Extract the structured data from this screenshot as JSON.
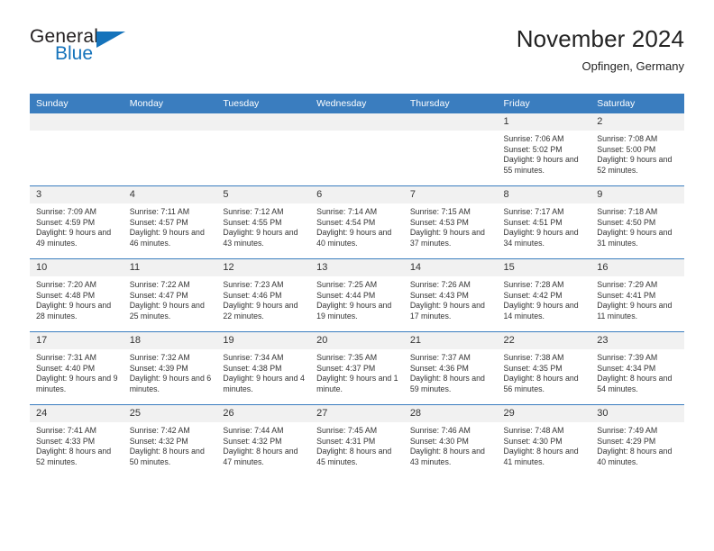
{
  "brand": {
    "name_part1": "General",
    "name_part2": "Blue",
    "triangle_icon": "triangle-icon",
    "accent_color": "#1573bb"
  },
  "header": {
    "title": "November 2024",
    "subtitle": "Opfingen, Germany",
    "header_bg_color": "#3a7dbf",
    "daynum_bg_color": "#f1f1f1"
  },
  "weekday_headers": [
    "Sunday",
    "Monday",
    "Tuesday",
    "Wednesday",
    "Thursday",
    "Friday",
    "Saturday"
  ],
  "labels": {
    "sunrise_prefix": "Sunrise:",
    "sunset_prefix": "Sunset:",
    "daylight_prefix": "Daylight:"
  },
  "weeks": [
    [
      {
        "day": "",
        "empty": true
      },
      {
        "day": "",
        "empty": true
      },
      {
        "day": "",
        "empty": true
      },
      {
        "day": "",
        "empty": true
      },
      {
        "day": "",
        "empty": true
      },
      {
        "day": "1",
        "sunrise": "Sunrise: 7:06 AM",
        "sunset": "Sunset: 5:02 PM",
        "daylight": "Daylight: 9 hours and 55 minutes."
      },
      {
        "day": "2",
        "sunrise": "Sunrise: 7:08 AM",
        "sunset": "Sunset: 5:00 PM",
        "daylight": "Daylight: 9 hours and 52 minutes."
      }
    ],
    [
      {
        "day": "3",
        "sunrise": "Sunrise: 7:09 AM",
        "sunset": "Sunset: 4:59 PM",
        "daylight": "Daylight: 9 hours and 49 minutes."
      },
      {
        "day": "4",
        "sunrise": "Sunrise: 7:11 AM",
        "sunset": "Sunset: 4:57 PM",
        "daylight": "Daylight: 9 hours and 46 minutes."
      },
      {
        "day": "5",
        "sunrise": "Sunrise: 7:12 AM",
        "sunset": "Sunset: 4:55 PM",
        "daylight": "Daylight: 9 hours and 43 minutes."
      },
      {
        "day": "6",
        "sunrise": "Sunrise: 7:14 AM",
        "sunset": "Sunset: 4:54 PM",
        "daylight": "Daylight: 9 hours and 40 minutes."
      },
      {
        "day": "7",
        "sunrise": "Sunrise: 7:15 AM",
        "sunset": "Sunset: 4:53 PM",
        "daylight": "Daylight: 9 hours and 37 minutes."
      },
      {
        "day": "8",
        "sunrise": "Sunrise: 7:17 AM",
        "sunset": "Sunset: 4:51 PM",
        "daylight": "Daylight: 9 hours and 34 minutes."
      },
      {
        "day": "9",
        "sunrise": "Sunrise: 7:18 AM",
        "sunset": "Sunset: 4:50 PM",
        "daylight": "Daylight: 9 hours and 31 minutes."
      }
    ],
    [
      {
        "day": "10",
        "sunrise": "Sunrise: 7:20 AM",
        "sunset": "Sunset: 4:48 PM",
        "daylight": "Daylight: 9 hours and 28 minutes."
      },
      {
        "day": "11",
        "sunrise": "Sunrise: 7:22 AM",
        "sunset": "Sunset: 4:47 PM",
        "daylight": "Daylight: 9 hours and 25 minutes."
      },
      {
        "day": "12",
        "sunrise": "Sunrise: 7:23 AM",
        "sunset": "Sunset: 4:46 PM",
        "daylight": "Daylight: 9 hours and 22 minutes."
      },
      {
        "day": "13",
        "sunrise": "Sunrise: 7:25 AM",
        "sunset": "Sunset: 4:44 PM",
        "daylight": "Daylight: 9 hours and 19 minutes."
      },
      {
        "day": "14",
        "sunrise": "Sunrise: 7:26 AM",
        "sunset": "Sunset: 4:43 PM",
        "daylight": "Daylight: 9 hours and 17 minutes."
      },
      {
        "day": "15",
        "sunrise": "Sunrise: 7:28 AM",
        "sunset": "Sunset: 4:42 PM",
        "daylight": "Daylight: 9 hours and 14 minutes."
      },
      {
        "day": "16",
        "sunrise": "Sunrise: 7:29 AM",
        "sunset": "Sunset: 4:41 PM",
        "daylight": "Daylight: 9 hours and 11 minutes."
      }
    ],
    [
      {
        "day": "17",
        "sunrise": "Sunrise: 7:31 AM",
        "sunset": "Sunset: 4:40 PM",
        "daylight": "Daylight: 9 hours and 9 minutes."
      },
      {
        "day": "18",
        "sunrise": "Sunrise: 7:32 AM",
        "sunset": "Sunset: 4:39 PM",
        "daylight": "Daylight: 9 hours and 6 minutes."
      },
      {
        "day": "19",
        "sunrise": "Sunrise: 7:34 AM",
        "sunset": "Sunset: 4:38 PM",
        "daylight": "Daylight: 9 hours and 4 minutes."
      },
      {
        "day": "20",
        "sunrise": "Sunrise: 7:35 AM",
        "sunset": "Sunset: 4:37 PM",
        "daylight": "Daylight: 9 hours and 1 minute."
      },
      {
        "day": "21",
        "sunrise": "Sunrise: 7:37 AM",
        "sunset": "Sunset: 4:36 PM",
        "daylight": "Daylight: 8 hours and 59 minutes."
      },
      {
        "day": "22",
        "sunrise": "Sunrise: 7:38 AM",
        "sunset": "Sunset: 4:35 PM",
        "daylight": "Daylight: 8 hours and 56 minutes."
      },
      {
        "day": "23",
        "sunrise": "Sunrise: 7:39 AM",
        "sunset": "Sunset: 4:34 PM",
        "daylight": "Daylight: 8 hours and 54 minutes."
      }
    ],
    [
      {
        "day": "24",
        "sunrise": "Sunrise: 7:41 AM",
        "sunset": "Sunset: 4:33 PM",
        "daylight": "Daylight: 8 hours and 52 minutes."
      },
      {
        "day": "25",
        "sunrise": "Sunrise: 7:42 AM",
        "sunset": "Sunset: 4:32 PM",
        "daylight": "Daylight: 8 hours and 50 minutes."
      },
      {
        "day": "26",
        "sunrise": "Sunrise: 7:44 AM",
        "sunset": "Sunset: 4:32 PM",
        "daylight": "Daylight: 8 hours and 47 minutes."
      },
      {
        "day": "27",
        "sunrise": "Sunrise: 7:45 AM",
        "sunset": "Sunset: 4:31 PM",
        "daylight": "Daylight: 8 hours and 45 minutes."
      },
      {
        "day": "28",
        "sunrise": "Sunrise: 7:46 AM",
        "sunset": "Sunset: 4:30 PM",
        "daylight": "Daylight: 8 hours and 43 minutes."
      },
      {
        "day": "29",
        "sunrise": "Sunrise: 7:48 AM",
        "sunset": "Sunset: 4:30 PM",
        "daylight": "Daylight: 8 hours and 41 minutes."
      },
      {
        "day": "30",
        "sunrise": "Sunrise: 7:49 AM",
        "sunset": "Sunset: 4:29 PM",
        "daylight": "Daylight: 8 hours and 40 minutes."
      }
    ]
  ]
}
